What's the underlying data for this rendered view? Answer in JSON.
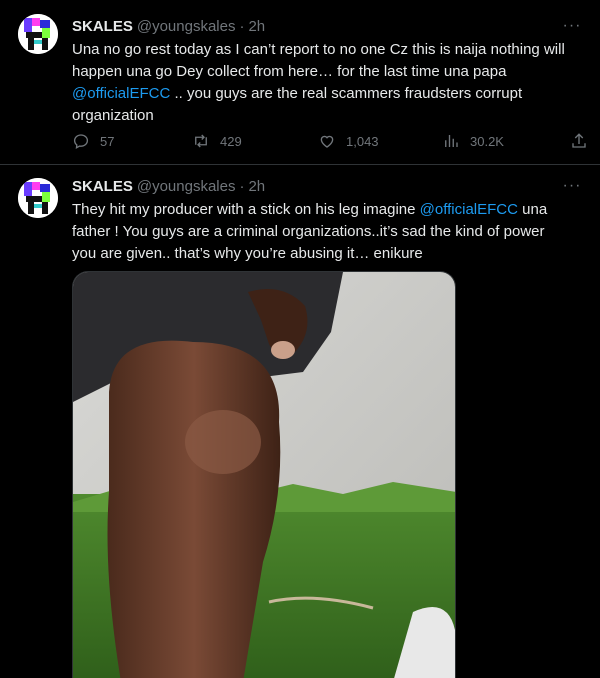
{
  "tweets": [
    {
      "name": "SKALES",
      "handle": "@youngskales",
      "separator": "·",
      "time": "2h",
      "text_parts": {
        "before": "Una no go rest today as I can’t report to no one Cz this is naija nothing will happen una go Dey collect from here… for the last time una papa ",
        "mention": "@officialEFCC",
        "after": " .. you guys are the real scammers fraudsters corrupt organization"
      },
      "replies": "57",
      "reposts": "429",
      "likes": "1,043",
      "views": "30.2K"
    },
    {
      "name": "SKALES",
      "handle": "@youngskales",
      "separator": "·",
      "time": "2h",
      "text_parts": {
        "before": "They hit my producer with a stick on his leg imagine ",
        "mention": "@officialEFCC",
        "after": " una father ! You guys are a criminal organizations..it’s sad the kind of power you are given.. that’s why you’re abusing it… enikure"
      }
    }
  ],
  "colors": {
    "background": "#000000",
    "text": "#e7e9ea",
    "muted": "#71767b",
    "mention": "#1d9bf0",
    "divider": "#2f3336"
  },
  "icons": [
    "avatar-image",
    "more-icon",
    "reply-icon",
    "repost-icon",
    "like-icon",
    "views-icon",
    "share-icon"
  ]
}
